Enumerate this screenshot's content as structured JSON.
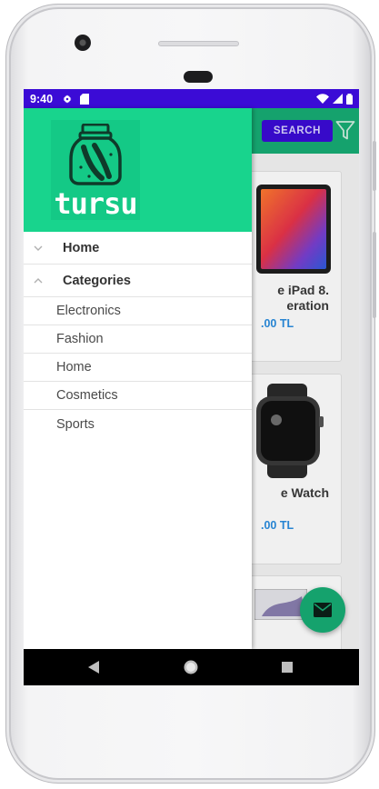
{
  "status_bar": {
    "time": "9:40",
    "bg_color": "#3b0bd6"
  },
  "app_header": {
    "search_label": "SEARCH",
    "filter_icon": "filter-icon",
    "bg_color": "#17ad74"
  },
  "products": [
    {
      "name": "e iPad 8.",
      "name_line2": "eration",
      "price": ".00 TL",
      "image_icon": "tablet-image"
    },
    {
      "name": "e Watch",
      "price": ".00 TL",
      "image_icon": "smartwatch-image"
    },
    {
      "image_icon": "laptop-image"
    }
  ],
  "fab": {
    "icon": "email-icon",
    "color": "#17ad74"
  },
  "drawer": {
    "header_color": "#18d48d",
    "logo_text": "tursu",
    "logo_icon": "pickle-jar-icon",
    "items": [
      {
        "label": "Home",
        "chevron": "chevron-down-icon"
      },
      {
        "label": "Categories",
        "chevron": "chevron-up-icon"
      }
    ],
    "categories": [
      {
        "label": "Electronics"
      },
      {
        "label": "Fashion"
      },
      {
        "label": "Home"
      },
      {
        "label": "Cosmetics"
      },
      {
        "label": "Sports"
      }
    ]
  },
  "nav_bar": {
    "back_icon": "back-triangle-icon",
    "home_icon": "home-circle-icon",
    "recents_icon": "recents-square-icon"
  }
}
